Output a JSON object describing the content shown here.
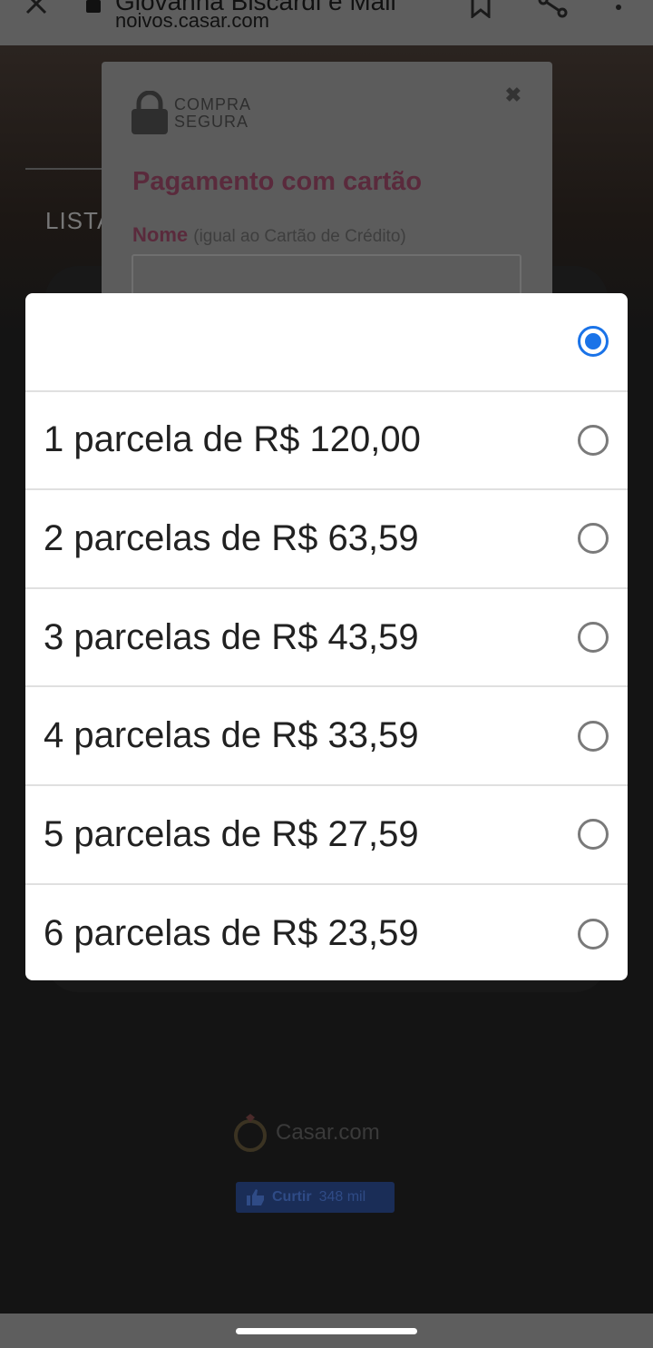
{
  "browser": {
    "title": "Giovanna Biscardi e Mall",
    "url": "noivos.casar.com"
  },
  "page": {
    "section_label": "LISTA",
    "footer_logo": "Casar.com",
    "like_button": {
      "label": "Curtir",
      "count": "348 mil"
    }
  },
  "payment_dialog": {
    "secure_line1": "COMPRA",
    "secure_line2": "SEGURA",
    "close_glyph": "✖",
    "title": "Pagamento com cartão",
    "name_label": "Nome",
    "name_hint": "(igual ao Cartão de Crédito)",
    "name_value": ""
  },
  "installments": {
    "selected_index": 0,
    "options": [
      {
        "label": ""
      },
      {
        "label": "1 parcela de R$ 120,00"
      },
      {
        "label": "2 parcelas de R$ 63,59"
      },
      {
        "label": "3 parcelas de R$ 43,59"
      },
      {
        "label": "4 parcelas de R$ 33,59"
      },
      {
        "label": "5 parcelas de R$ 27,59"
      },
      {
        "label": "6 parcelas de R$ 23,59"
      }
    ]
  },
  "colors": {
    "accent": "#1a73e8",
    "brand_pink": "#5a2a3c"
  }
}
